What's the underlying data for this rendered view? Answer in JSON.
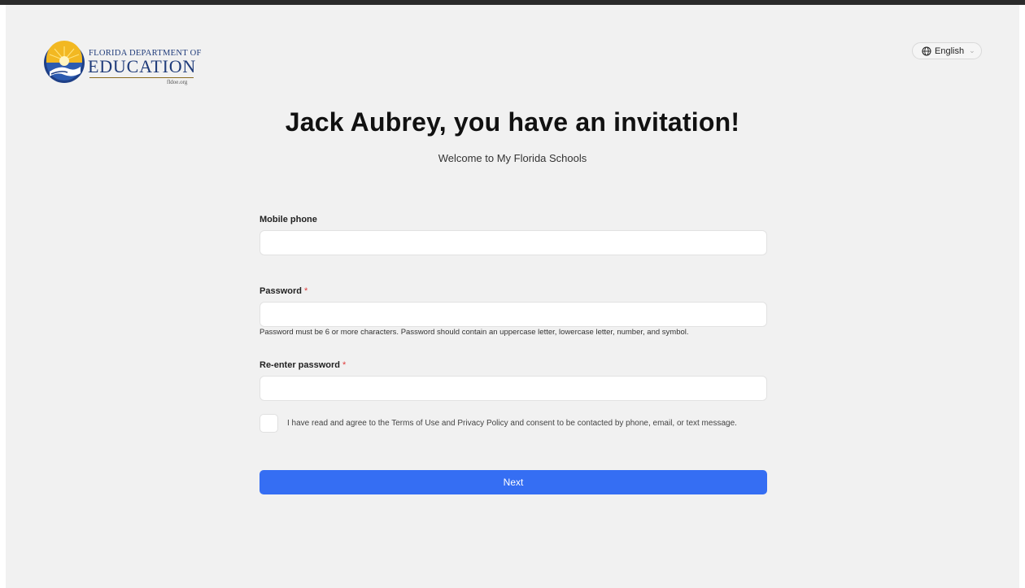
{
  "logo": {
    "line1": "FLORIDA DEPARTMENT OF",
    "line2": "EDUCATION",
    "url": "fldoe.org"
  },
  "language": {
    "icon": "globe-icon",
    "selected": "English",
    "chevron": "chevron-down-icon"
  },
  "heading": {
    "title": "Jack Aubrey, you have an invitation!",
    "subtitle": "Welcome to My Florida Schools"
  },
  "form": {
    "mobile_label": "Mobile phone",
    "mobile_value": "",
    "password_label": "Password",
    "password_value": "",
    "password_hint": "Password must be 6 or more characters. Password should contain an uppercase letter, lowercase letter, number, and symbol.",
    "reenter_label": "Re-enter password",
    "reenter_value": "",
    "required_marker": "*",
    "consent_checked": false,
    "consent_text": "I have read and agree to the Terms of Use and Privacy Policy and consent to be contacted by phone, email, or text message.",
    "next_label": "Next"
  },
  "colors": {
    "primary_button": "#356ef3",
    "required": "#e03b3b",
    "background": "#f1f1f1",
    "logo_blue": "#1f3b7a"
  }
}
